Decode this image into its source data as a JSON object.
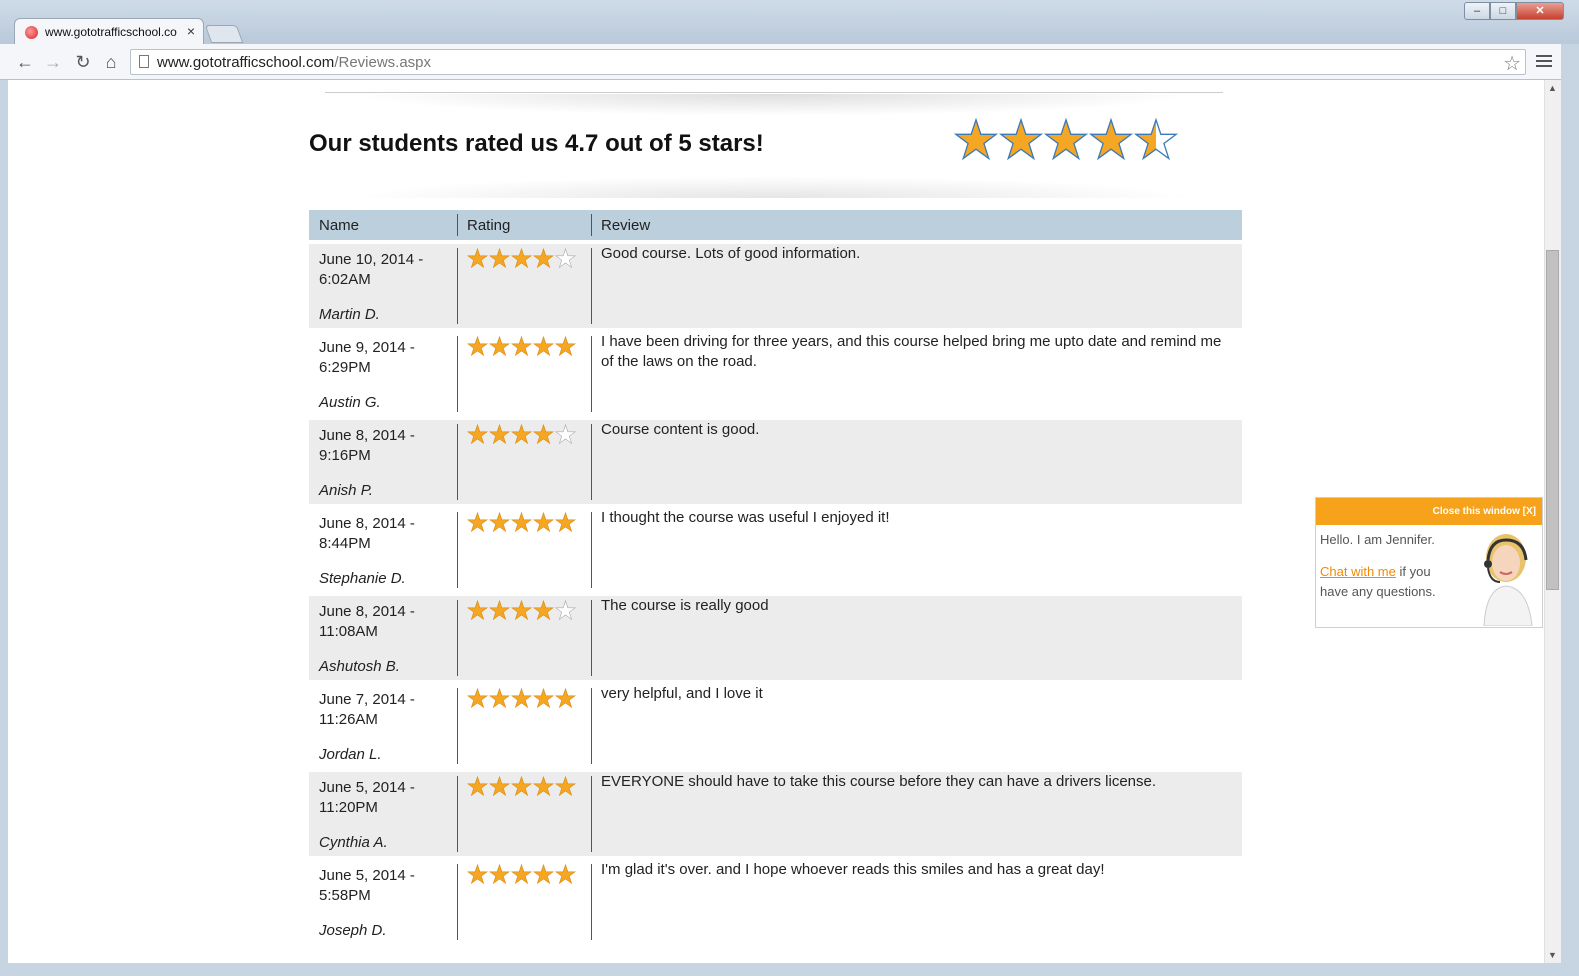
{
  "browser": {
    "tab_title": "www.gototrafficschool.co",
    "url_host": "www.gototrafficschool.com",
    "url_path": "/Reviews.aspx"
  },
  "page": {
    "headline": "Our students rated us 4.7 out of 5 stars!",
    "overall_rating": 4.7,
    "overall_rating_max": 5
  },
  "table": {
    "headers": [
      "Name",
      "Rating",
      "Review"
    ],
    "rows": [
      {
        "date": "June 10, 2014 - 6:02AM",
        "name": "Martin D.",
        "rating": 4,
        "review": "Good course. Lots of good information."
      },
      {
        "date": "June 9, 2014 - 6:29PM",
        "name": "Austin G.",
        "rating": 5,
        "review": "I have been driving for three years, and this course helped bring me upto date and remind me of the laws on the road."
      },
      {
        "date": "June 8, 2014 - 9:16PM",
        "name": "Anish P.",
        "rating": 4,
        "review": "Course content is good."
      },
      {
        "date": "June 8, 2014 - 8:44PM",
        "name": "Stephanie D.",
        "rating": 5,
        "review": "I thought the course was useful I enjoyed it!"
      },
      {
        "date": "June 8, 2014 - 11:08AM",
        "name": "Ashutosh B.",
        "rating": 4,
        "review": "The course is really good"
      },
      {
        "date": "June 7, 2014 - 11:26AM",
        "name": "Jordan L.",
        "rating": 5,
        "review": "very helpful, and I love it"
      },
      {
        "date": "June 5, 2014 - 11:20PM",
        "name": "Cynthia A.",
        "rating": 5,
        "review": "EVERYONE should have to take this course before they can have a drivers license."
      },
      {
        "date": "June 5, 2014 - 5:58PM",
        "name": "Joseph D.",
        "rating": 5,
        "review": "I'm glad it's over. and I hope whoever reads this smiles and has a great day!"
      }
    ]
  },
  "chat": {
    "close_label": "Close this window [X]",
    "greeting": "Hello. I am Jennifer.",
    "link_label": "Chat with me",
    "suffix": " if you have any questions."
  },
  "colors": {
    "star": "#f5a623",
    "header_bg": "#bccfdd",
    "row_alt_bg": "#ececec",
    "chat_accent": "#f7a21b"
  }
}
